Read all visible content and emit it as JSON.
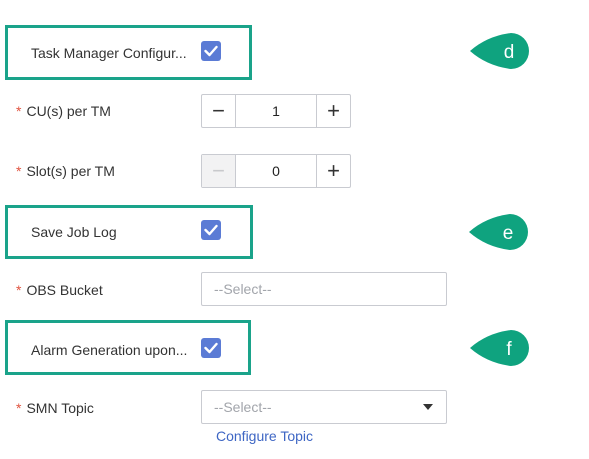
{
  "colors": {
    "highlight_border": "#1aa38a",
    "marker_fill": "#0fa37f",
    "checkbox_fill": "#5b7bd5",
    "required_star": "#e0533f",
    "link": "#3e66c4"
  },
  "task_manager_config": {
    "label": "Task Manager Configur...",
    "checked": true,
    "marker": "d"
  },
  "cus_per_tm": {
    "required": "*",
    "label": "CU(s) per TM",
    "value": "1",
    "minus": "−",
    "plus": "+"
  },
  "slots_per_tm": {
    "required": "*",
    "label": "Slot(s) per TM",
    "value": "0",
    "minus": "−",
    "plus": "+"
  },
  "save_job_log": {
    "label": "Save Job Log",
    "checked": true,
    "marker": "e"
  },
  "obs_bucket": {
    "required": "*",
    "label": "OBS Bucket",
    "placeholder": "--Select--"
  },
  "alarm_generation": {
    "label": "Alarm Generation upon...",
    "checked": true,
    "marker": "f"
  },
  "smn_topic": {
    "required": "*",
    "label": "SMN Topic",
    "placeholder": "--Select--",
    "configure_link": "Configure Topic"
  }
}
